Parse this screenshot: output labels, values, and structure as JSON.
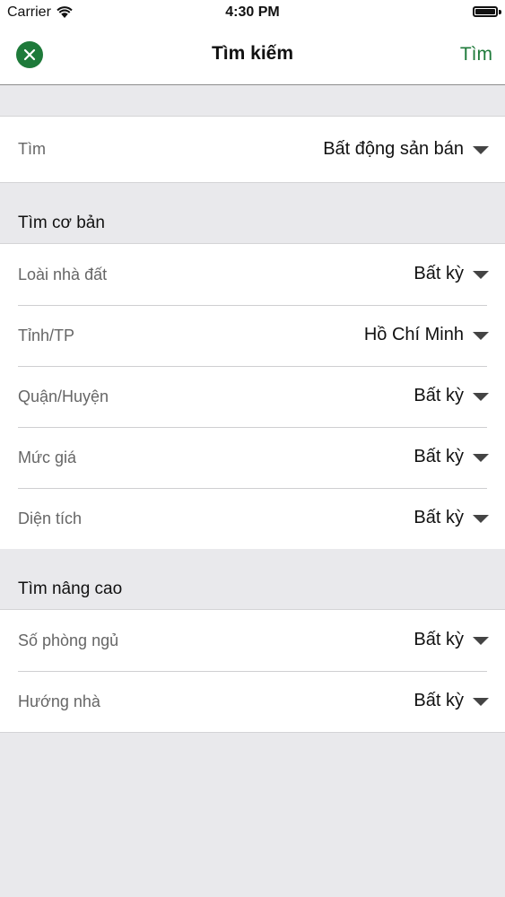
{
  "status_bar": {
    "carrier": "Carrier",
    "time": "4:30 PM"
  },
  "nav": {
    "title": "Tìm kiếm",
    "action": "Tìm",
    "accent_color": "#1e7a3a",
    "close_icon": "close-icon"
  },
  "search_type": {
    "label": "Tìm",
    "value": "Bất động sản bán"
  },
  "basic": {
    "header": "Tìm cơ bản",
    "rows": [
      {
        "label": "Loài nhà đất",
        "value": "Bất kỳ"
      },
      {
        "label": "Tỉnh/TP",
        "value": "Hồ Chí Minh"
      },
      {
        "label": "Quận/Huyện",
        "value": "Bất kỳ"
      },
      {
        "label": "Mức giá",
        "value": "Bất kỳ"
      },
      {
        "label": "Diện tích",
        "value": "Bất kỳ"
      }
    ]
  },
  "advanced": {
    "header": "Tìm nâng cao",
    "rows": [
      {
        "label": "Số phòng ngủ",
        "value": "Bất kỳ"
      },
      {
        "label": "Hướng nhà",
        "value": "Bất kỳ"
      }
    ]
  }
}
